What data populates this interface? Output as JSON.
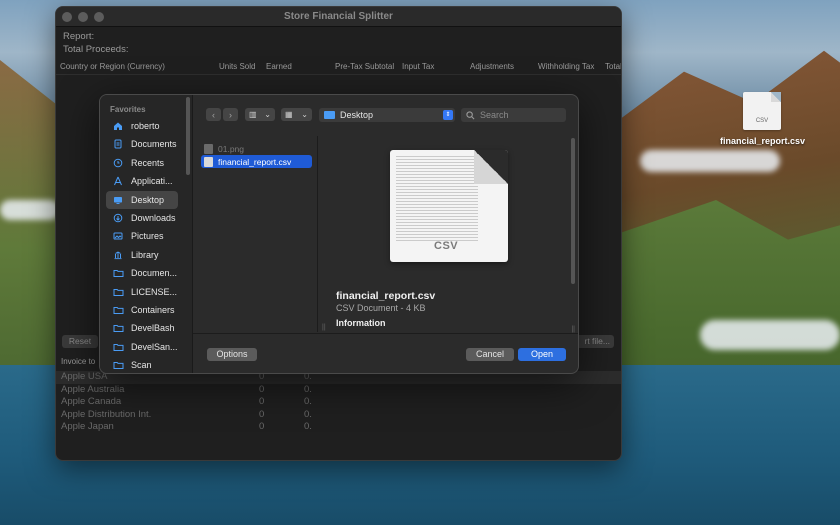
{
  "desktop": {
    "file_icon_label": "CSV",
    "file_name": "financial_report.csv"
  },
  "app": {
    "title": "Store Financial Splitter",
    "report_label": "Report:",
    "total_proceeds_label": "Total Proceeds:",
    "columns": [
      "Country or Region (Currency)",
      "Units Sold",
      "Earned",
      "Pre-Tax Subtotal",
      "Input Tax",
      "Adjustments",
      "Withholding Tax",
      "Total"
    ],
    "reset_label": "Reset",
    "export_label": "rt file...",
    "invoice_label": "Invoice to",
    "invoices": [
      {
        "name": "Apple USA",
        "units": "0",
        "earned": "0."
      },
      {
        "name": "Apple Australia",
        "units": "0",
        "earned": "0."
      },
      {
        "name": "Apple Canada",
        "units": "0",
        "earned": "0."
      },
      {
        "name": "Apple Distribution Int.",
        "units": "0",
        "earned": "0."
      },
      {
        "name": "Apple Japan",
        "units": "0",
        "earned": "0."
      }
    ]
  },
  "dialog": {
    "sidebar_header": "Favorites",
    "sidebar": [
      {
        "label": "roberto",
        "icon": "home-icon"
      },
      {
        "label": "Documents",
        "icon": "document-icon"
      },
      {
        "label": "Recents",
        "icon": "clock-icon"
      },
      {
        "label": "Applicati...",
        "icon": "applications-icon"
      },
      {
        "label": "Desktop",
        "icon": "desktop-icon"
      },
      {
        "label": "Downloads",
        "icon": "download-icon"
      },
      {
        "label": "Pictures",
        "icon": "pictures-icon"
      },
      {
        "label": "Library",
        "icon": "library-icon"
      },
      {
        "label": "Documen...",
        "icon": "folder-icon"
      },
      {
        "label": "LICENSE...",
        "icon": "folder-icon"
      },
      {
        "label": "Containers",
        "icon": "folder-icon"
      },
      {
        "label": "DevelBash",
        "icon": "folder-icon"
      },
      {
        "label": "DevelSan...",
        "icon": "folder-icon"
      },
      {
        "label": "Scan",
        "icon": "folder-icon"
      }
    ],
    "active_sidebar_index": 4,
    "location": "Desktop",
    "search_placeholder": "Search",
    "files": [
      {
        "name": "01.png",
        "dim": true
      },
      {
        "name": "financial_report.csv",
        "selected": true
      }
    ],
    "preview": {
      "icon_label": "CSV",
      "name": "financial_report.csv",
      "kind": "CSV Document - 4 KB",
      "info_label": "Information"
    },
    "options_label": "Options",
    "cancel_label": "Cancel",
    "open_label": "Open"
  },
  "colors": {
    "accent": "#2d6fe0",
    "selection": "#1f5bd6",
    "sidebar_icon": "#4a9cf5"
  }
}
